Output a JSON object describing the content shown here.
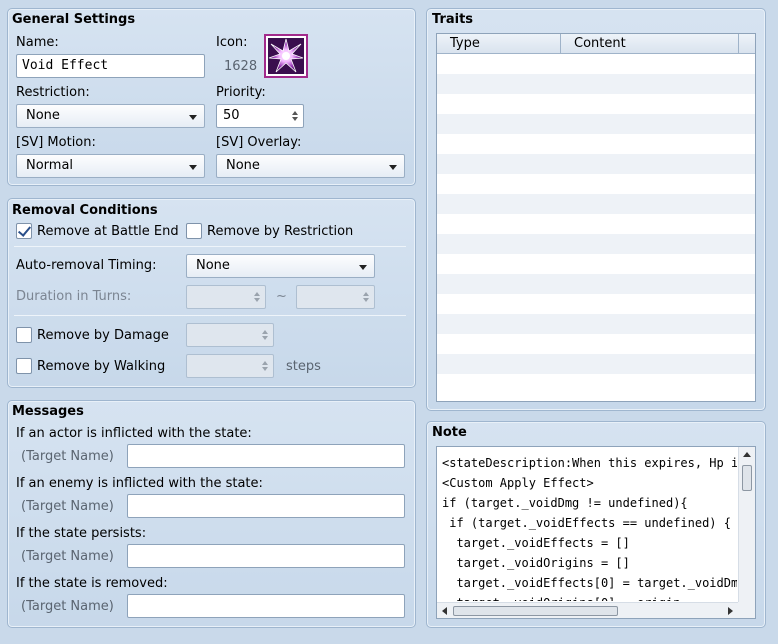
{
  "general": {
    "title": "General Settings",
    "name_label": "Name:",
    "name_value": "Void Effect",
    "icon_label": "Icon:",
    "icon_index": "1628",
    "restriction_label": "Restriction:",
    "restriction_value": "None",
    "priority_label": "Priority:",
    "priority_value": "50",
    "sv_motion_label": "[SV] Motion:",
    "sv_motion_value": "Normal",
    "sv_overlay_label": "[SV] Overlay:",
    "sv_overlay_value": "None"
  },
  "removal": {
    "title": "Removal Conditions",
    "remove_battle_end": "Remove at Battle End",
    "remove_by_restriction": "Remove by Restriction",
    "auto_timing_label": "Auto-removal Timing:",
    "auto_timing_value": "None",
    "duration_label": "Duration in Turns:",
    "duration_sep": "~",
    "remove_by_damage": "Remove by Damage",
    "remove_by_walking": "Remove by Walking",
    "steps_label": "steps"
  },
  "messages": {
    "title": "Messages",
    "actor_label": "If an actor is inflicted with the state:",
    "enemy_label": "If an enemy is inflicted with the state:",
    "persists_label": "If the state persists:",
    "removed_label": "If the state is removed:",
    "target_name": "(Target Name)"
  },
  "traits": {
    "title": "Traits",
    "col_type": "Type",
    "col_content": "Content"
  },
  "note": {
    "title": "Note",
    "text": "<stateDescription:When this expires, Hp is\n<Custom Apply Effect>\nif (target._voidDmg != undefined){\n if (target._voidEffects == undefined) {\n  target._voidEffects = []\n  target._voidOrigins = []\n  target._voidEffects[0] = target._voidDmg\n  target._voidOrigins[0] = origin"
  }
}
